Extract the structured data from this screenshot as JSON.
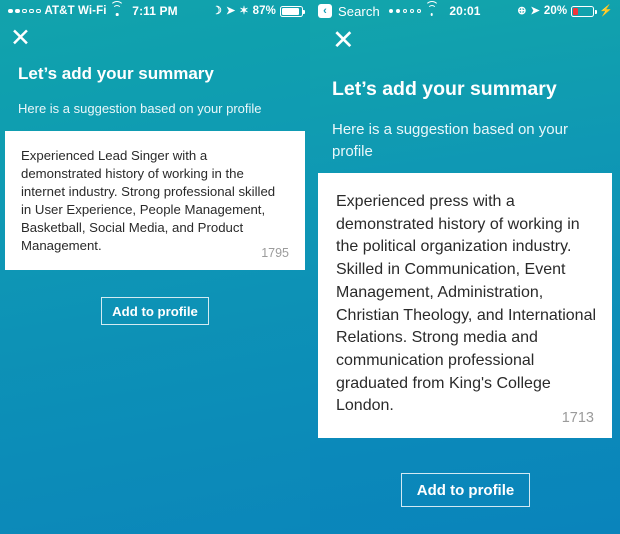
{
  "screens": [
    {
      "id": "left-screen",
      "status_bar": {
        "signal_dots": [
          true,
          true,
          false,
          false,
          false
        ],
        "carrier": "AT&T Wi-Fi",
        "wifi_icon": "wifi-icon",
        "time": "7:11 PM",
        "right_icons": [
          "moon-icon",
          "location-arrow-icon",
          "bluetooth-icon"
        ],
        "battery_percent": "87%",
        "battery_level": 87,
        "battery_color": "#ffffff",
        "charging": false,
        "back_label": null
      },
      "close_label": "✕",
      "title": "Let’s add your summary",
      "subtitle": "Here is a suggestion based on your profile",
      "card": {
        "text": "Experienced Lead Singer with a demonstrated history of working in the internet industry. Strong professional skilled in User Experience, People Management, Basketball, Social Media, and Product Management.",
        "char_count": "1795"
      },
      "add_button_label": "Add to profile"
    },
    {
      "id": "right-screen",
      "status_bar": {
        "back_label": "Search",
        "back_chevron": "‹",
        "signal_dots": [
          true,
          true,
          false,
          false,
          false
        ],
        "carrier": null,
        "wifi_icon": "wifi-icon",
        "time": "20:01",
        "right_icons": [
          "do-not-disturb-icon",
          "location-arrow-icon"
        ],
        "battery_percent": "20%",
        "battery_level": 20,
        "battery_color": "#f3343a",
        "charging": true,
        "charging_glyph": "⚡"
      },
      "close_label": "✕",
      "title": "Let’s add your summary",
      "subtitle": "Here is a suggestion based on your profile",
      "card": {
        "text": "Experienced press with a demonstrated history of working in the political organization industry. Skilled in Communication, Event Management, Administration, Christian Theology, and International Relations. Strong media and communication professional graduated from King's College London.",
        "char_count": "1713"
      },
      "add_button_label": "Add to profile"
    }
  ],
  "colors": {
    "gradient_top": "#12a4ac",
    "gradient_bottom": "#0a86bb",
    "card_background": "#ffffff",
    "card_text": "#2a2a2a",
    "char_count_text": "#9b9b9b",
    "title_text": "#ffffff",
    "battery_low": "#f3343a"
  }
}
